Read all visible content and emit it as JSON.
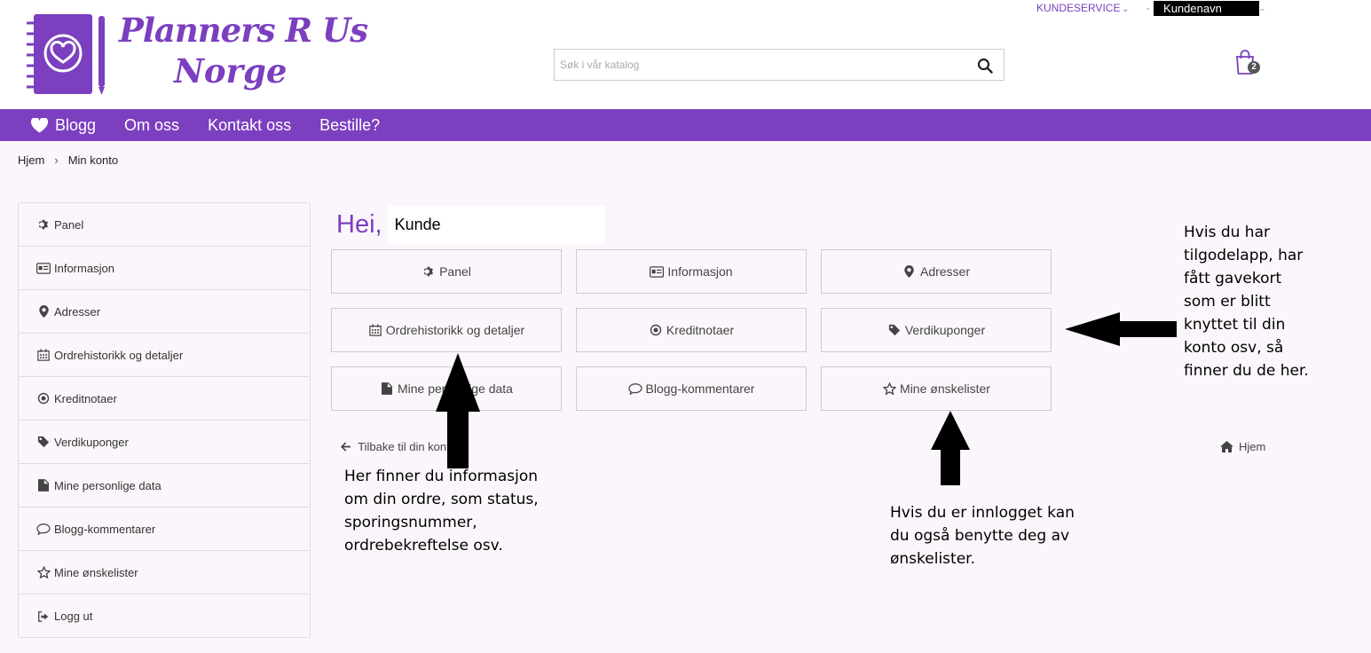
{
  "header": {
    "logo_line1": "Planners R Us",
    "logo_line2": "Norge",
    "kundeservice": "KUNDESERVICE",
    "separator": "-",
    "customer_name": "Kundenavn",
    "search_placeholder": "Søk i vår katalog",
    "cart_count": "2"
  },
  "nav": {
    "items": [
      "Blogg",
      "Om oss",
      "Kontakt oss",
      "Bestille?"
    ]
  },
  "breadcrumb": {
    "home": "Hjem",
    "current": "Min konto"
  },
  "sidebar": {
    "items": [
      {
        "label": "Panel",
        "icon": "gear-icon"
      },
      {
        "label": "Informasjon",
        "icon": "id-card-icon"
      },
      {
        "label": "Adresser",
        "icon": "map-marker-icon"
      },
      {
        "label": "Ordrehistorikk og detaljer",
        "icon": "calendar-icon"
      },
      {
        "label": "Kreditnotaer",
        "icon": "dot-circle-icon"
      },
      {
        "label": "Verdikuponger",
        "icon": "tag-icon"
      },
      {
        "label": "Mine personlige data",
        "icon": "document-icon"
      },
      {
        "label": "Blogg-kommentarer",
        "icon": "comment-icon"
      },
      {
        "label": "Mine ønskelister",
        "icon": "star-icon"
      },
      {
        "label": "Logg ut",
        "icon": "sign-out-icon"
      }
    ]
  },
  "main": {
    "greeting": "Hei,",
    "customer": "Kunde",
    "tiles": [
      {
        "label": "Panel",
        "icon": "gear-icon"
      },
      {
        "label": "Informasjon",
        "icon": "id-card-icon"
      },
      {
        "label": "Adresser",
        "icon": "map-marker-icon"
      },
      {
        "label": "Ordrehistorikk og detaljer",
        "icon": "calendar-icon"
      },
      {
        "label": "Kreditnotaer",
        "icon": "dot-circle-icon"
      },
      {
        "label": "Verdikuponger",
        "icon": "tag-icon"
      },
      {
        "label": "Mine personlige data",
        "icon": "document-icon"
      },
      {
        "label": "Blogg-kommentarer",
        "icon": "comment-icon"
      },
      {
        "label": "Mine ønskelister",
        "icon": "star-icon"
      }
    ],
    "back_label": "Tilbake til din konto",
    "home_label": "Hjem"
  },
  "annotations": {
    "note_coupons": "Hvis du har tilgodelapp, har fått gavekort som er blitt knyttet til din konto osv, så finner du de her.",
    "note_orders": "Her finner du informasjon om din ordre, som status, sporingsnummer, ordrebekreftelse osv.",
    "note_wishlist": "Hvis du er innlogget kan du også benytte deg av ønskelister."
  },
  "colors": {
    "brand": "#7b3fbf",
    "background": "#fbf6fb"
  }
}
